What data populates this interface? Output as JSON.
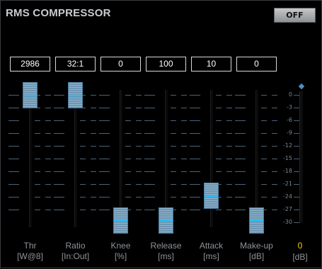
{
  "title": "RMS COMPRESSOR",
  "off_button_label": "OFF",
  "accent_colors": {
    "thumb_line": "#1ec3ff",
    "gain_value": "#f2d300",
    "meter_marker": "#4e8fc2"
  },
  "channels": [
    {
      "value": "2986",
      "label": "Thr",
      "unit": "[W@8]",
      "level": 1.0
    },
    {
      "value": "32:1",
      "label": "Ratio",
      "unit": "[In:Out]",
      "level": 1.0
    },
    {
      "value": "0",
      "label": "Knee",
      "unit": "[%]",
      "level": 0.0
    },
    {
      "value": "100",
      "label": "Release",
      "unit": "[ms]",
      "level": 0.0
    },
    {
      "value": "10",
      "label": "Attack",
      "unit": "[ms]",
      "level": 0.2
    },
    {
      "value": "0",
      "label": "Make-up",
      "unit": "[dB]",
      "level": 0.0
    }
  ],
  "gain_reduction_meter": {
    "scale_labels": [
      "0",
      "-3",
      "-6",
      "-9",
      "-12",
      "-15",
      "-18",
      "-21",
      "-24",
      "-27",
      "-30"
    ],
    "value": "0",
    "unit": "[dB]"
  }
}
